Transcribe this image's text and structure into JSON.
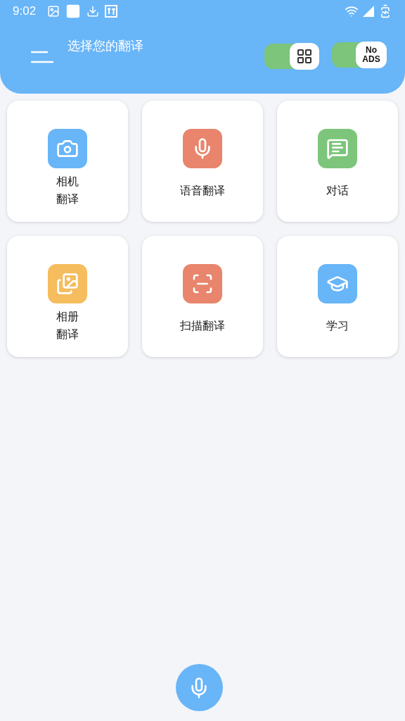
{
  "status_bar": {
    "time": "9:02"
  },
  "header": {
    "title": "选择您的翻译",
    "apps_toggle": {
      "on": true
    },
    "no_ads_toggle": {
      "on": true,
      "label": "No ADS"
    }
  },
  "tiles": [
    {
      "label": "相机翻译",
      "wrapped": true,
      "kind": "camera",
      "color": "#68b5f8"
    },
    {
      "label": "语音翻译",
      "wrapped": false,
      "kind": "mic",
      "color": "#e8856c"
    },
    {
      "label": "对话",
      "kind": "chat",
      "color": "#7cc57a"
    },
    {
      "label": "相册翻译",
      "wrapped": true,
      "kind": "gallery",
      "color": "#f5bd5e"
    },
    {
      "label": "扫描翻译",
      "wrapped": false,
      "kind": "scan",
      "color": "#e8856c"
    },
    {
      "label": "学习",
      "kind": "study",
      "color": "#68b5f8"
    }
  ]
}
